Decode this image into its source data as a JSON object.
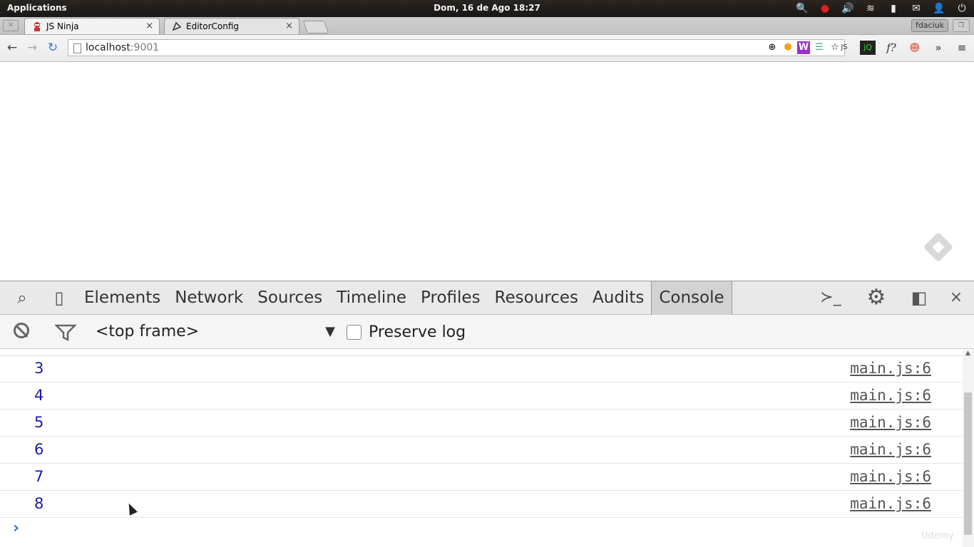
{
  "system_bar": {
    "apps_label": "Applications",
    "clock": "Dom, 16 de Ago 18:27"
  },
  "tabs": [
    {
      "title": "JS Ninja",
      "close": "×"
    },
    {
      "title": "EditorConfig",
      "close": "×"
    }
  ],
  "profile_name": "fdaciuk",
  "toolbar": {
    "back": "←",
    "forward": "→",
    "reload": "↻",
    "url_host": "localhost",
    "url_port": ":9001"
  },
  "devtools": {
    "tabs": [
      "Elements",
      "Network",
      "Sources",
      "Timeline",
      "Profiles",
      "Resources",
      "Audits",
      "Console"
    ],
    "active_tab": "Console",
    "frame_select": "<top frame>",
    "preserve_log_label": "Preserve log",
    "preserve_log_checked": false,
    "close": "×"
  },
  "console": {
    "rows": [
      {
        "value": "3",
        "source": "main.js:6"
      },
      {
        "value": "4",
        "source": "main.js:6"
      },
      {
        "value": "5",
        "source": "main.js:6"
      },
      {
        "value": "6",
        "source": "main.js:6"
      },
      {
        "value": "7",
        "source": "main.js:6"
      },
      {
        "value": "8",
        "source": "main.js:6"
      }
    ],
    "prompt": "›"
  },
  "watermark": "Udemy"
}
